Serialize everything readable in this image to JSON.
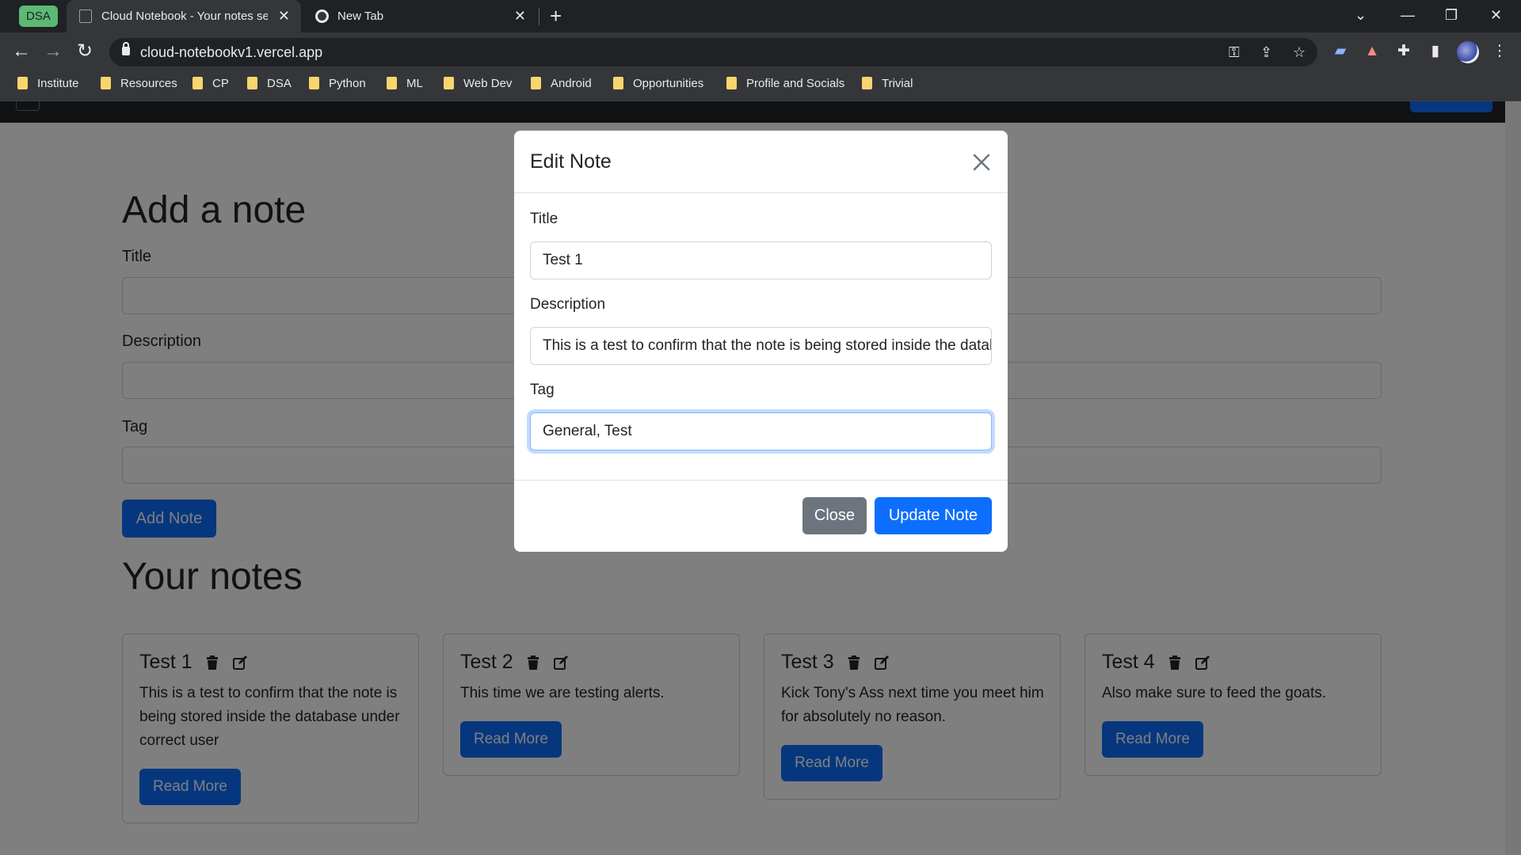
{
  "browser": {
    "tab_group_label": "DSA",
    "tabs": [
      {
        "title": "Cloud Notebook - Your notes secured",
        "active": true
      },
      {
        "title": "New Tab",
        "active": false
      }
    ],
    "url": "cloud-notebookv1.vercel.app",
    "bookmarks": [
      "Institute",
      "Resources",
      "CP",
      "DSA",
      "Python",
      "ML",
      "Web Dev",
      "Android",
      "Opportunities",
      "Profile and Socials",
      "Trivial"
    ]
  },
  "form": {
    "heading": "Add a note",
    "title_label": "Title",
    "description_label": "Description",
    "tag_label": "Tag",
    "add_button": "Add Note"
  },
  "notes_section": {
    "heading": "Your notes",
    "read_more_label": "Read More",
    "notes": [
      {
        "title": "Test 1",
        "description": "This is a test to confirm that the note is being stored inside the database under correct user"
      },
      {
        "title": "Test 2",
        "description": "This time we are testing alerts."
      },
      {
        "title": "Test 3",
        "description": "Kick Tony's Ass next time you meet him for absolutely no reason."
      },
      {
        "title": "Test 4",
        "description": "Also make sure to feed the goats."
      }
    ]
  },
  "modal": {
    "title": "Edit Note",
    "title_label": "Title",
    "title_value": "Test 1",
    "description_label": "Description",
    "description_value": "This is a test to confirm that the note is being stored inside the database under correct user",
    "tag_label": "Tag",
    "tag_value": "General, Test",
    "close_button": "Close",
    "update_button": "Update Note"
  },
  "colors": {
    "primary": "#0d6efd",
    "secondary": "#6c757d",
    "navbar": "#212529",
    "tab_group": "#5bb974"
  }
}
